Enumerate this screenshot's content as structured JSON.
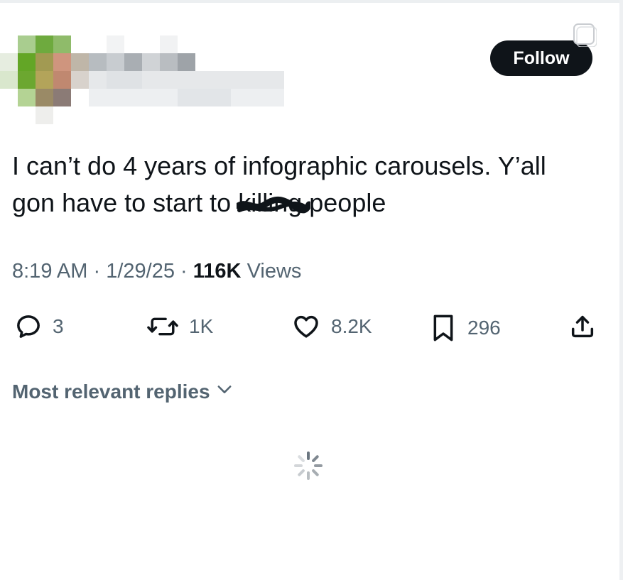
{
  "header": {
    "follow_label": "Follow"
  },
  "tweet": {
    "text_before": "I can’t do 4 years of infographic carousels. Y’all gon have to start to ",
    "censored_word": "killing",
    "text_after": " people"
  },
  "meta": {
    "time": "8:19 AM",
    "separator": "·",
    "date": "1/29/25",
    "views_count": "116K",
    "views_label": "Views"
  },
  "actions": {
    "replies": "3",
    "reposts": "1K",
    "likes": "8.2K",
    "bookmarks": "296"
  },
  "replies_sort": {
    "label": "Most relevant replies"
  },
  "icons": {
    "reply": "reply-icon",
    "repost": "repost-icon",
    "like": "heart-icon",
    "bookmark": "bookmark-icon",
    "share": "share-icon",
    "chevron": "chevron-down-icon",
    "spinner": "loading-spinner-icon"
  },
  "colors": {
    "text": "#0f1419",
    "muted": "#536471",
    "button": "#0f1419"
  }
}
